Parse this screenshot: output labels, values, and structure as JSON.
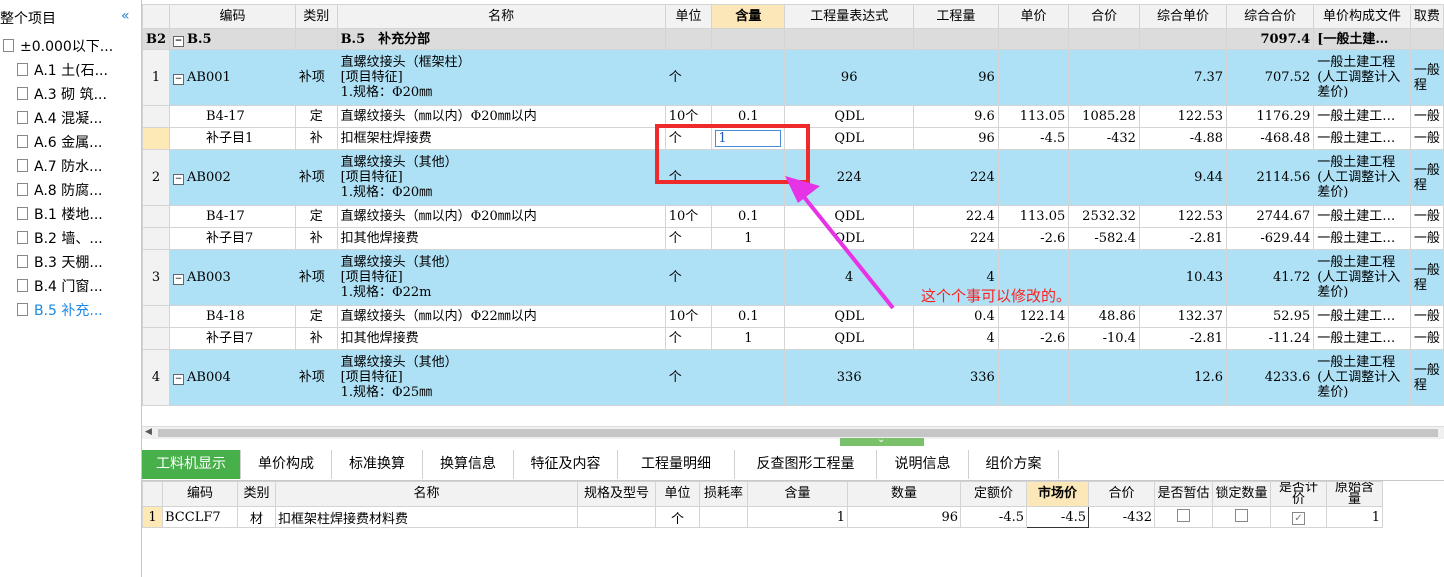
{
  "sidebar": {
    "root": "整个项目",
    "collapse_icon": "«",
    "items": [
      {
        "label": "±0.000以下..."
      },
      {
        "label": "A.1 土(石..."
      },
      {
        "label": "A.3 砌 筑..."
      },
      {
        "label": "A.4 混凝..."
      },
      {
        "label": "A.6 金属..."
      },
      {
        "label": "A.7 防水..."
      },
      {
        "label": "A.8 防腐..."
      },
      {
        "label": "B.1 楼地..."
      },
      {
        "label": "B.2 墙、..."
      },
      {
        "label": "B.3 天棚..."
      },
      {
        "label": "B.4 门窗..."
      },
      {
        "label": "B.5 补充..."
      }
    ]
  },
  "grid": {
    "headers": [
      "",
      "编码",
      "类别",
      "名称",
      "单位",
      "含量",
      "工程量表达式",
      "工程量",
      "单价",
      "合价",
      "综合单价",
      "综合合价",
      "单价构成文件",
      "取费"
    ],
    "category": {
      "rownum": "B2",
      "code": "B.5",
      "name": "B.5　补充分部",
      "total": "7097.4",
      "file": "[一般土建…"
    },
    "items": [
      {
        "rownum": "1",
        "code": "AB001",
        "type": "补项",
        "name1": "直螺纹接头（框架柱）",
        "name2": "[项目特征]",
        "name3": "1.规格：Φ20㎜",
        "unit": "个",
        "expr": "96",
        "qty": "96",
        "uprice": "7.37",
        "total": "707.52",
        "file": "一般土建工程(人工调整计入差价)",
        "fee": "一般程",
        "subs": [
          {
            "code": "B4-17",
            "type": "定",
            "name": "直螺纹接头（㎜以内）Φ20㎜以内",
            "unit": "10个",
            "content": "0.1",
            "expr": "QDL",
            "qty": "9.6",
            "price": "113.05",
            "amount": "1085.28",
            "uprice": "122.53",
            "total": "1176.29",
            "file": "一般土建工…",
            "fee": "一般"
          },
          {
            "code": "补子目1",
            "type": "补",
            "name": "扣框架柱焊接费",
            "unit": "个",
            "content": "1",
            "expr": "QDL",
            "qty": "96",
            "price": "-4.5",
            "amount": "-432",
            "uprice": "-4.88",
            "total": "-468.48",
            "file": "一般土建工…",
            "fee": "一般"
          }
        ]
      },
      {
        "rownum": "2",
        "code": "AB002",
        "type": "补项",
        "name1": "直螺纹接头（其他）",
        "name2": "[项目特征]",
        "name3": "1.规格：Φ20㎜",
        "unit": "个",
        "expr": "224",
        "qty": "224",
        "uprice": "9.44",
        "total": "2114.56",
        "file": "一般土建工程(人工调整计入差价)",
        "fee": "一般程",
        "subs": [
          {
            "code": "B4-17",
            "type": "定",
            "name": "直螺纹接头（㎜以内）Φ20㎜以内",
            "unit": "10个",
            "content": "0.1",
            "expr": "QDL",
            "qty": "22.4",
            "price": "113.05",
            "amount": "2532.32",
            "uprice": "122.53",
            "total": "2744.67",
            "file": "一般土建工…",
            "fee": "一般"
          },
          {
            "code": "补子目7",
            "type": "补",
            "name": "扣其他焊接费",
            "unit": "个",
            "content": "1",
            "expr": "QDL",
            "qty": "224",
            "price": "-2.6",
            "amount": "-582.4",
            "uprice": "-2.81",
            "total": "-629.44",
            "file": "一般土建工…",
            "fee": "一般"
          }
        ]
      },
      {
        "rownum": "3",
        "code": "AB003",
        "type": "补项",
        "name1": "直螺纹接头（其他）",
        "name2": "[项目特征]",
        "name3": "1.规格：Φ22m",
        "unit": "个",
        "expr": "4",
        "qty": "4",
        "uprice": "10.43",
        "total": "41.72",
        "file": "一般土建工程(人工调整计入差价)",
        "fee": "一般程",
        "subs": [
          {
            "code": "B4-18",
            "type": "定",
            "name": "直螺纹接头（㎜以内）Φ22㎜以内",
            "unit": "10个",
            "content": "0.1",
            "expr": "QDL",
            "qty": "0.4",
            "price": "122.14",
            "amount": "48.86",
            "uprice": "132.37",
            "total": "52.95",
            "file": "一般土建工…",
            "fee": "一般"
          },
          {
            "code": "补子目7",
            "type": "补",
            "name": "扣其他焊接费",
            "unit": "个",
            "content": "1",
            "expr": "QDL",
            "qty": "4",
            "price": "-2.6",
            "amount": "-10.4",
            "uprice": "-2.81",
            "total": "-11.24",
            "file": "一般土建工…",
            "fee": "一般"
          }
        ]
      },
      {
        "rownum": "4",
        "code": "AB004",
        "type": "补项",
        "name1": "直螺纹接头（其他）",
        "name2": "[项目特征]",
        "name3": "1.规格：Φ25㎜",
        "unit": "个",
        "expr": "336",
        "qty": "336",
        "uprice": "12.6",
        "total": "4233.6",
        "file": "一般土建工程(人工调整计入差价)",
        "fee": "一般程",
        "subs": []
      }
    ],
    "edit_value": "1"
  },
  "tabs": [
    "工料机显示",
    "单价构成",
    "标准换算",
    "换算信息",
    "特征及内容",
    "工程量明细",
    "反查图形工程量",
    "说明信息",
    "组价方案"
  ],
  "bottom": {
    "headers": [
      "",
      "编码",
      "类别",
      "名称",
      "规格及型号",
      "单位",
      "损耗率",
      "含量",
      "数量",
      "定额价",
      "市场价",
      "合价",
      "是否暂估",
      "锁定数量",
      "是否计价",
      "原始含量"
    ],
    "row": {
      "num": "1",
      "code": "BCCLF7",
      "type": "材",
      "name": "扣框架柱焊接费材料费",
      "spec": "",
      "unit": "个",
      "loss": "",
      "content": "1",
      "qty": "96",
      "price": "-4.5",
      "market": "-4.5",
      "amount": "-432",
      "orig": "1"
    }
  },
  "annotation": {
    "note": "这个个事可以修改的。",
    "color": "#ef2a2a",
    "arrow_color": "#e533e5"
  }
}
